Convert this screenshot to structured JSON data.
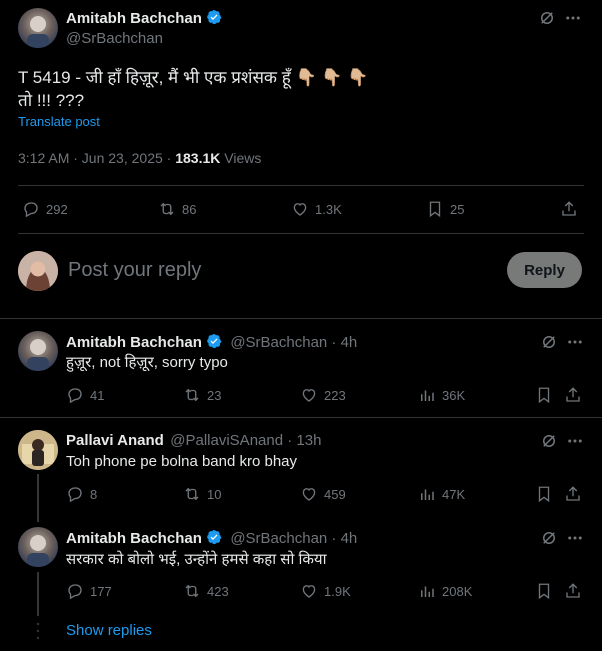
{
  "main_post": {
    "author_name": "Amitabh Bachchan",
    "author_handle": "@SrBachchan",
    "text_line1": "T 5419 - जी हाँ हिज़ूर, मैं भी एक प्रशंसक हूँ 👇🏼 👇🏼 👇🏼",
    "text_line2": "तो !!! ???",
    "translate": "Translate post",
    "time": "3:12 AM · Jun 23, 2025 · ",
    "views": "183.1K",
    "views_label": " Views",
    "stats": {
      "replies": "292",
      "reposts": "86",
      "likes": "1.3K",
      "bookmarks": "25"
    }
  },
  "reply_box": {
    "placeholder": "Post your reply",
    "button": "Reply"
  },
  "replies": [
    {
      "author_name": "Amitabh Bachchan",
      "author_handle": "@SrBachchan · 4h",
      "text": "हुज़ूर, not हिज़ूर, sorry typo",
      "replies": "41",
      "reposts": "23",
      "likes": "223",
      "views": "36K"
    },
    {
      "author_name": "Pallavi Anand",
      "author_handle": "@PallaviSAnand · 13h",
      "text": "Toh phone pe bolna band kro bhay",
      "replies": "8",
      "reposts": "10",
      "likes": "459",
      "views": "47K"
    },
    {
      "author_name": "Amitabh Bachchan",
      "author_handle": "@SrBachchan · 4h",
      "text": "सरकार को बोलो भई, उन्होंने हमसे कहा सो किया",
      "replies": "177",
      "reposts": "423",
      "likes": "1.9K",
      "views": "208K"
    }
  ],
  "show_replies": "Show replies",
  "colors": {
    "background": "#000000",
    "text": "#e7e9ea",
    "muted": "#71767b",
    "accent": "#1d9bf0",
    "divider": "#2f3336"
  }
}
